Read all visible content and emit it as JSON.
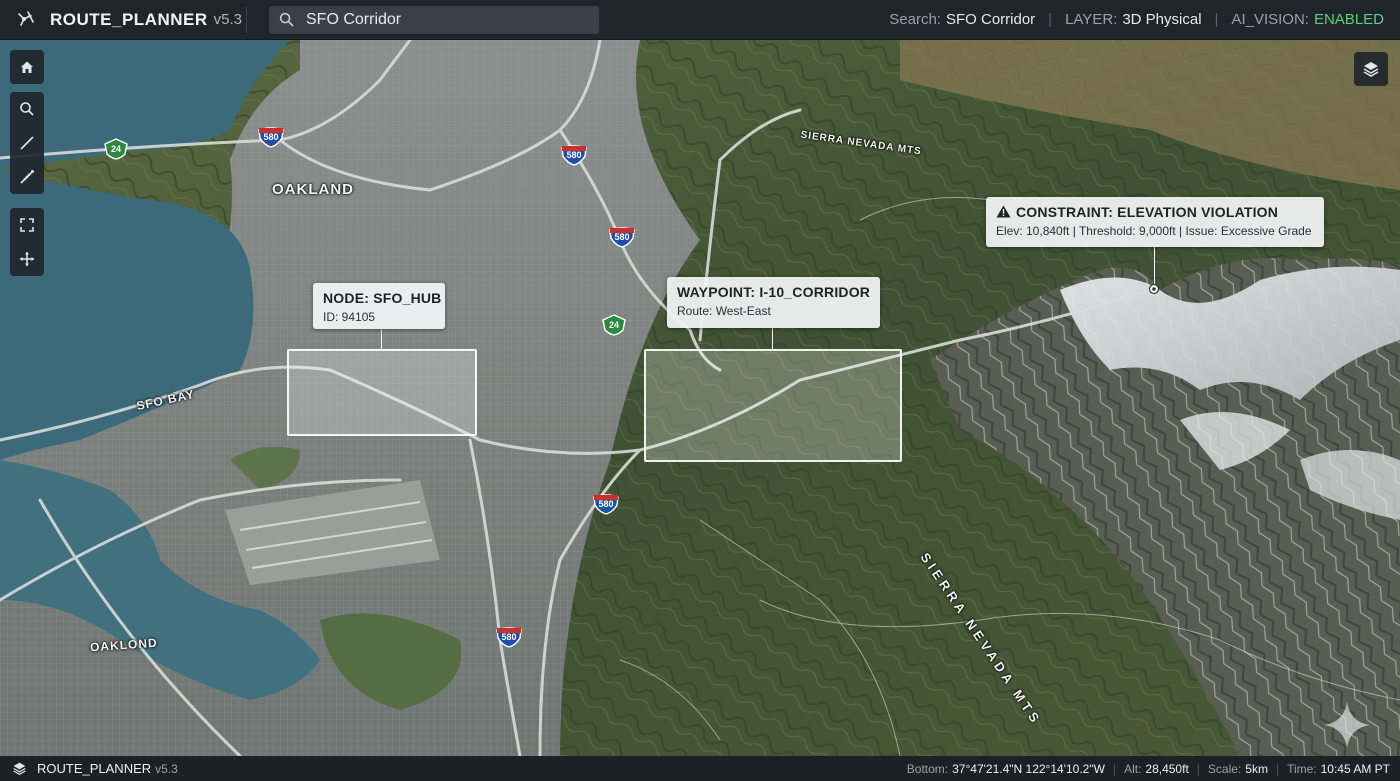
{
  "app": {
    "name": "ROUTE_PLANNER",
    "version": "v5.3"
  },
  "search": {
    "value": "SFO Corridor",
    "placeholder": ""
  },
  "status": {
    "search_label": "Search:",
    "search_value": "SFO Corridor",
    "layer_label": "LAYER:",
    "layer_value": "3D Physical",
    "vision_label": "AI_VISION:",
    "vision_value": "ENABLED",
    "vision_color": "#5fd17a"
  },
  "tools": {
    "group1": [
      "home-icon",
      "search-icon",
      "line-icon",
      "ruler-icon"
    ],
    "group2": [
      "fullscreen-icon",
      "pan-icon"
    ],
    "layers": "layers-icon"
  },
  "map_labels": {
    "oakland": "OAKLAND",
    "oaklond": "OAKLOND",
    "sfo_bay": "SFO BAY",
    "sierra_small": "SIERRA NEVADA MTS",
    "sierra_large": "SIERRA NEVADA MTS"
  },
  "shields": [
    {
      "id": "580",
      "kind": "interstate"
    },
    {
      "id": "24",
      "kind": "state"
    },
    {
      "id": "580",
      "kind": "interstate"
    },
    {
      "id": "580",
      "kind": "interstate"
    },
    {
      "id": "24",
      "kind": "state"
    },
    {
      "id": "580",
      "kind": "interstate"
    },
    {
      "id": "580",
      "kind": "interstate"
    }
  ],
  "callouts": {
    "node": {
      "title": "NODE: SFO_HUB",
      "sub": "ID: 94105"
    },
    "waypoint": {
      "title": "WAYPOINT: I-10_CORRIDOR",
      "sub": "Route: West-East"
    },
    "constraint": {
      "title": "CONSTRAINT: ELEVATION VIOLATION",
      "sub": "Elev: 10,840ft | Threshold: 9,000ft | Issue: Excessive Grade",
      "icon": "warning-icon"
    }
  },
  "bottom": {
    "app_name": "ROUTE_PLANNER",
    "version": "v5.3",
    "bottom_label": "Bottom:",
    "bottom_value": "37°47'21.4\"N 122°14'10.2\"W",
    "alt_label": "Alt:",
    "alt_value": "28,450ft",
    "scale_label": "Scale:",
    "scale_value": "5km",
    "time_label": "Time:",
    "time_value": "10:45 AM PT"
  },
  "colors": {
    "interstate": "#1f4fa8",
    "state": "#2c8a3e",
    "water": "#3d6a7a",
    "accent_green": "#5fd17a"
  }
}
